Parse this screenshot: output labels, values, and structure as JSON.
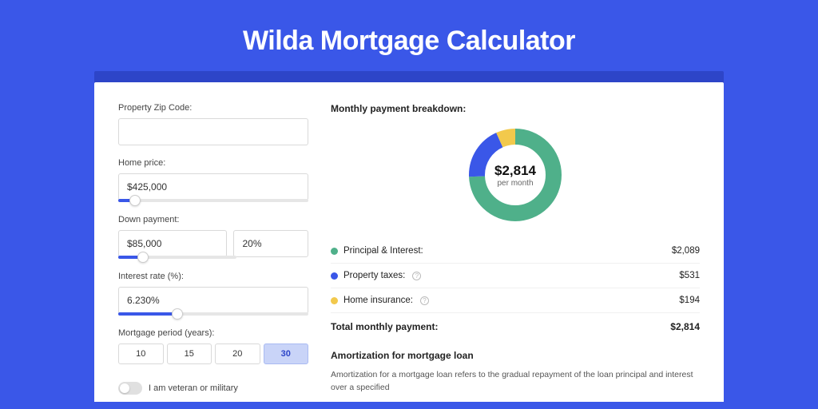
{
  "title": "Wilda Mortgage Calculator",
  "form": {
    "zip_label": "Property Zip Code:",
    "zip_value": "",
    "price_label": "Home price:",
    "price_value": "$425,000",
    "price_slider_pct": 9,
    "down_label": "Down payment:",
    "down_value": "$85,000",
    "down_pct_value": "20%",
    "down_slider_pct": 21,
    "rate_label": "Interest rate (%):",
    "rate_value": "6.230%",
    "rate_slider_pct": 31,
    "period_label": "Mortgage period (years):",
    "periods": [
      "10",
      "15",
      "20",
      "30"
    ],
    "period_active_index": 3,
    "veteran_label": "I am veteran or military"
  },
  "breakdown": {
    "heading": "Monthly payment breakdown:",
    "center_amount": "$2,814",
    "center_sub": "per month",
    "items": [
      {
        "label": "Principal & Interest:",
        "value": "$2,089",
        "color": "green",
        "info": false
      },
      {
        "label": "Property taxes:",
        "value": "$531",
        "color": "blue",
        "info": true
      },
      {
        "label": "Home insurance:",
        "value": "$194",
        "color": "yellow",
        "info": true
      }
    ],
    "total_label": "Total monthly payment:",
    "total_value": "$2,814"
  },
  "amortization": {
    "heading": "Amortization for mortgage loan",
    "text": "Amortization for a mortgage loan refers to the gradual repayment of the loan principal and interest over a specified"
  },
  "chart_data": {
    "type": "pie",
    "title": "Monthly payment breakdown",
    "series": [
      {
        "name": "Principal & Interest",
        "value": 2089,
        "color": "#4fb08a"
      },
      {
        "name": "Property taxes",
        "value": 531,
        "color": "#3a57e8"
      },
      {
        "name": "Home insurance",
        "value": 194,
        "color": "#f2c94c"
      }
    ],
    "total": 2814,
    "unit": "USD per month"
  }
}
